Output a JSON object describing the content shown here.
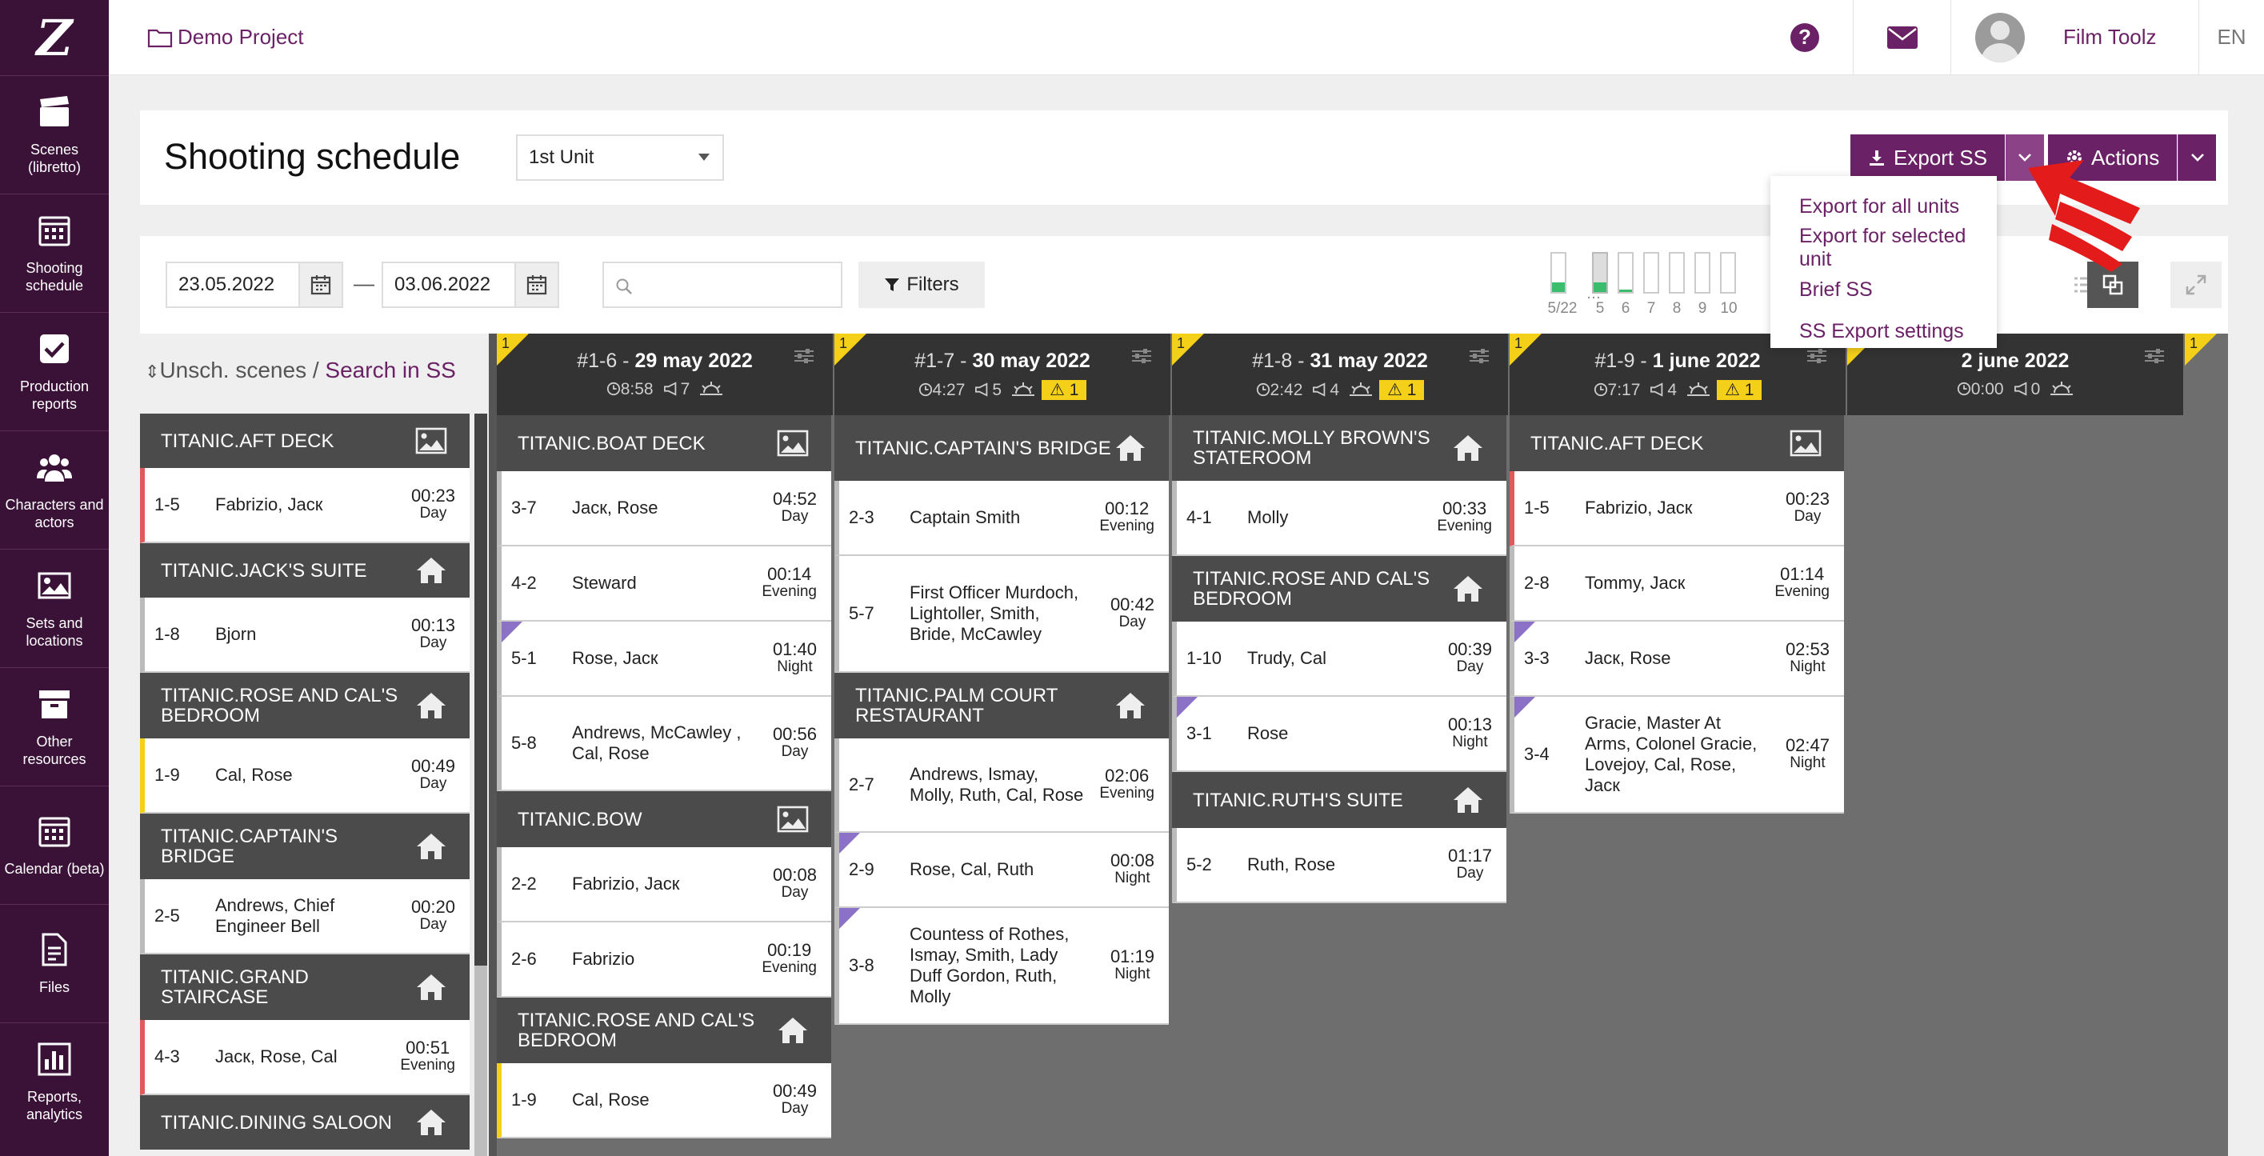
{
  "app": {
    "logo": "Z",
    "project": "Demo Project",
    "user_name": "Film Toolz",
    "lang": "EN",
    "help": "?"
  },
  "sidebar": {
    "items": [
      {
        "label": "Scenes (libretto)",
        "icon": "clapperboard-icon"
      },
      {
        "label": "Shooting schedule",
        "icon": "calendar-icon"
      },
      {
        "label": "Production reports",
        "icon": "checkbox-icon"
      },
      {
        "label": "Characters and actors",
        "icon": "users-icon"
      },
      {
        "label": "Sets and locations",
        "icon": "image-icon"
      },
      {
        "label": "Other resources",
        "icon": "archive-icon"
      },
      {
        "label": "Calendar (beta)",
        "icon": "calendar-icon"
      },
      {
        "label": "Files",
        "icon": "file-icon"
      },
      {
        "label": "Reports, analytics",
        "icon": "bar-chart-icon"
      }
    ]
  },
  "header": {
    "title": "Shooting schedule",
    "unit_select": "1st Unit",
    "export_label": "Export SS",
    "actions_label": "Actions"
  },
  "export_menu": [
    "Export for all units",
    "Export for selected unit",
    "Brief SS",
    "SS Export settings"
  ],
  "filters": {
    "date_from": "23.05.2022",
    "date_to": "03.06.2022",
    "dash": "—",
    "search_value": "",
    "filters_label": "Filters"
  },
  "mini_bars": {
    "labels": [
      "5/22",
      "…",
      "5",
      "6",
      "7",
      "8",
      "9",
      "10"
    ],
    "levels": [
      0.25,
      0,
      0.25,
      0.06,
      0,
      0,
      0,
      0
    ]
  },
  "left_column": {
    "title_unsched": "Unsch. scenes",
    "sep": " / ",
    "title_search": "Search in SS",
    "sort_icon": "⇕"
  },
  "unscheduled": [
    {
      "type": "loc",
      "name": "TITANIC.AFT DECK",
      "icon": "image-icon"
    },
    {
      "type": "scene",
      "num": "1-5",
      "chars": "Fabrizio, Jacк",
      "time": "00:23",
      "period": "Day",
      "stripe": "#e05a5a"
    },
    {
      "type": "loc",
      "name": "TITANIC.JACK'S SUITE",
      "icon": "house-icon"
    },
    {
      "type": "scene",
      "num": "1-8",
      "chars": "Bjorn",
      "time": "00:13",
      "period": "Day",
      "stripe": "#bbbbbb"
    },
    {
      "type": "loc",
      "name": "TITANIC.ROSE AND CAL'S BEDROOM",
      "icon": "house-icon"
    },
    {
      "type": "scene",
      "num": "1-9",
      "chars": "Cal, Rose",
      "time": "00:49",
      "period": "Day",
      "stripe": "#f5d019"
    },
    {
      "type": "loc",
      "name": "TITANIC.CAPTAIN'S BRIDGE",
      "icon": "house-icon"
    },
    {
      "type": "scene",
      "num": "2-5",
      "chars": "Andrews, Chief Engineer Bell",
      "time": "00:20",
      "period": "Day",
      "stripe": "#bbbbbb"
    },
    {
      "type": "loc",
      "name": "TITANIC.GRAND STAIRCASE",
      "icon": "house-icon"
    },
    {
      "type": "scene",
      "num": "4-3",
      "chars": "Jacк, Rose, Cal",
      "time": "00:51",
      "period": "Evening",
      "stripe": "#e05a5a"
    },
    {
      "type": "loc",
      "name": "TITANIC.DINING SALOON",
      "icon": "house-icon"
    }
  ],
  "days": [
    {
      "badge": "1",
      "title_prefix": "#1-6 - ",
      "title_date": "29 may 2022",
      "time": "8:58",
      "count": "7",
      "warn": "",
      "items": [
        {
          "type": "loc",
          "name": "TITANIC.BOAT DECK",
          "icon": "image-icon"
        },
        {
          "type": "scene",
          "num": "3-7",
          "chars": "Jacк, Rose",
          "time": "04:52",
          "period": "Day"
        },
        {
          "type": "scene",
          "num": "4-2",
          "chars": "Steward",
          "time": "00:14",
          "period": "Evening"
        },
        {
          "type": "scene",
          "num": "5-1",
          "chars": "Rose, Jacк",
          "time": "01:40",
          "period": "Night",
          "tri": true
        },
        {
          "type": "scene",
          "num": "5-8",
          "chars": "Andrews, McCawley , Cal, Rose",
          "time": "00:56",
          "period": "Day"
        },
        {
          "type": "loc",
          "name": "TITANIC.BOW",
          "icon": "image-icon"
        },
        {
          "type": "scene",
          "num": "2-2",
          "chars": "Fabrizio, Jacк",
          "time": "00:08",
          "period": "Day"
        },
        {
          "type": "scene",
          "num": "2-6",
          "chars": "Fabrizio",
          "time": "00:19",
          "period": "Evening"
        },
        {
          "type": "loc",
          "name": "TITANIC.ROSE AND CAL'S BEDROOM",
          "icon": "house-icon"
        },
        {
          "type": "scene",
          "num": "1-9",
          "chars": "Cal, Rose",
          "time": "00:49",
          "period": "Day",
          "stripe": "#f5d019"
        }
      ]
    },
    {
      "badge": "1",
      "title_prefix": "#1-7 - ",
      "title_date": "30 may 2022",
      "time": "4:27",
      "count": "5",
      "warn": "1",
      "items": [
        {
          "type": "loc",
          "name": "TITANIC.CAPTAIN'S BRIDGE",
          "icon": "house-icon"
        },
        {
          "type": "scene",
          "num": "2-3",
          "chars": "Captain Smith",
          "time": "00:12",
          "period": "Evening"
        },
        {
          "type": "scene",
          "num": "5-7",
          "chars": "First Officer Murdoch, Lightoller, Smith, Bride, McCawley",
          "time": "00:42",
          "period": "Day"
        },
        {
          "type": "loc",
          "name": "TITANIC.PALM COURT RESTAURANT",
          "icon": "house-icon"
        },
        {
          "type": "scene",
          "num": "2-7",
          "chars": "Andrews, Ismay, Molly, Ruth, Cal, Rose",
          "time": "02:06",
          "period": "Evening"
        },
        {
          "type": "scene",
          "num": "2-9",
          "chars": "Rose, Cal, Ruth",
          "time": "00:08",
          "period": "Night",
          "tri": true
        },
        {
          "type": "scene",
          "num": "3-8",
          "chars": "Countess of Rothes, Ismay, Smith, Lady Duff Gordon, Ruth, Molly",
          "time": "01:19",
          "period": "Night",
          "tri": true
        }
      ]
    },
    {
      "badge": "1",
      "title_prefix": "#1-8 - ",
      "title_date": "31 may 2022",
      "time": "2:42",
      "count": "4",
      "warn": "1",
      "items": [
        {
          "type": "loc",
          "name": "TITANIC.MOLLY BROWN'S STATEROOM",
          "icon": "house-icon"
        },
        {
          "type": "scene",
          "num": "4-1",
          "chars": "Molly",
          "time": "00:33",
          "period": "Evening"
        },
        {
          "type": "loc",
          "name": "TITANIC.ROSE AND CAL'S BEDROOM",
          "icon": "house-icon"
        },
        {
          "type": "scene",
          "num": "1-10",
          "chars": "Trudy, Cal",
          "time": "00:39",
          "period": "Day"
        },
        {
          "type": "scene",
          "num": "3-1",
          "chars": "Rose",
          "time": "00:13",
          "period": "Night",
          "tri": true
        },
        {
          "type": "loc",
          "name": "TITANIC.RUTH'S SUITE",
          "icon": "house-icon"
        },
        {
          "type": "scene",
          "num": "5-2",
          "chars": "Ruth, Rose",
          "time": "01:17",
          "period": "Day"
        }
      ]
    },
    {
      "badge": "1",
      "title_prefix": "#1-9 - ",
      "title_date": "1 june 2022",
      "time": "7:17",
      "count": "4",
      "warn": "1",
      "items": [
        {
          "type": "loc",
          "name": "TITANIC.AFT DECK",
          "icon": "image-icon"
        },
        {
          "type": "scene",
          "num": "1-5",
          "chars": "Fabrizio, Jacк",
          "time": "00:23",
          "period": "Day",
          "stripe": "#e05a5a"
        },
        {
          "type": "scene",
          "num": "2-8",
          "chars": "Tommy, Jacк",
          "time": "01:14",
          "period": "Evening"
        },
        {
          "type": "scene",
          "num": "3-3",
          "chars": "Jacк, Rose",
          "time": "02:53",
          "period": "Night",
          "tri": true
        },
        {
          "type": "scene",
          "num": "3-4",
          "chars": "Gracie, Master At Arms, Colonel Gracie, Lovejoy, Cal, Rose, Jacк",
          "time": "02:47",
          "period": "Night",
          "tri": true
        }
      ]
    },
    {
      "badge": "1",
      "title_prefix": "",
      "title_date": "2 june 2022",
      "time": "0:00",
      "count": "0",
      "warn": "",
      "items": []
    }
  ],
  "next_day_badge": "1",
  "colors": {
    "brand": "#6b2165",
    "brand_light": "#8b4287",
    "sidebar": "#3a1237",
    "warn": "#f5d019",
    "location_bar": "#4b4b4b"
  }
}
